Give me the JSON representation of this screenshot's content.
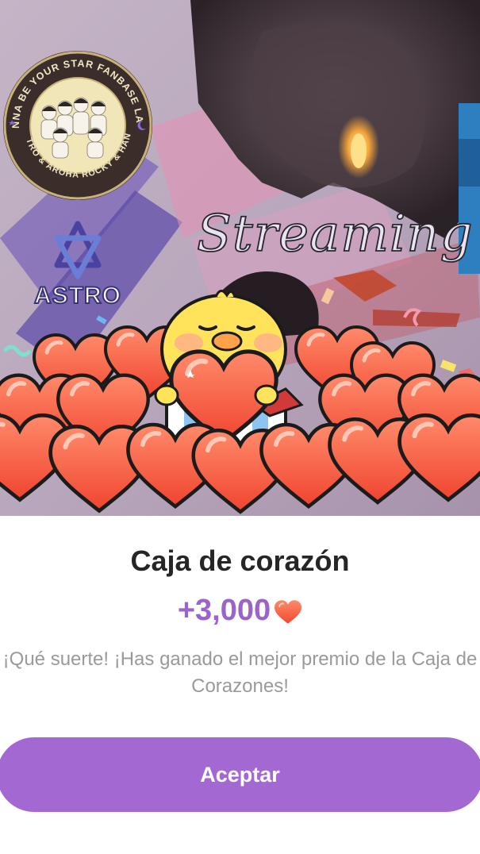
{
  "banner": {
    "fanbase_ring_text": "WANNA BE YOUR STAR FANBASE LATAM",
    "fanbase_bottom_text": "ASTRO & AROHA ROCKY & HANO",
    "astro_logo_text": "ASTRO",
    "overlay_text": "Streaming"
  },
  "reward": {
    "title": "Caja de corazón",
    "amount": "+3,000",
    "message": "¡Qué suerte! ¡Has ganado el mejor premio de la Caja de Corazones!"
  },
  "actions": {
    "accept_label": "Aceptar"
  },
  "colors": {
    "accent": "#a468d2",
    "amount_text": "#9a64c8",
    "heart": "#f0573e"
  },
  "icons": {
    "amount_icon": "heart-icon"
  }
}
